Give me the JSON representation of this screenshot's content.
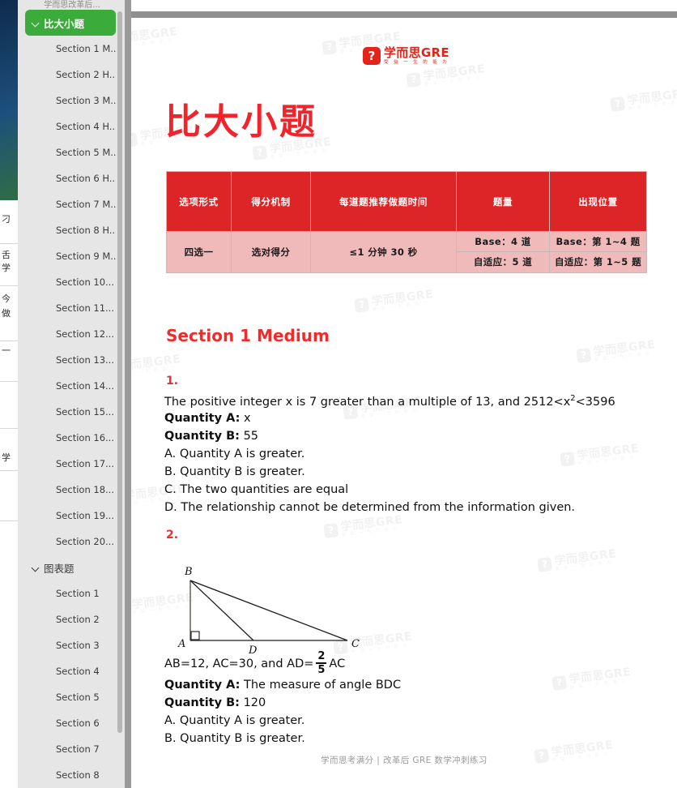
{
  "background_window": {
    "glyph_fragments": [
      "刁",
      "舌",
      "学",
      "今",
      "做",
      "一",
      "学"
    ]
  },
  "sidebar": {
    "partial_top_label": "学而思改革后...",
    "groups": [
      {
        "label": "比大小题",
        "expanded": true,
        "active": true,
        "icon": "chevron-down-icon",
        "items": [
          "Section 1 M...",
          "Section 2 H...",
          "Section 3 M...",
          "Section 4 H...",
          "Section 5 M...",
          "Section 6 H...",
          "Section 7 M...",
          "Section 8 H...",
          "Section 9 M...",
          "Section 10...",
          "Section 11...",
          "Section 12...",
          "Section 13...",
          "Section 14...",
          "Section 15...",
          "Section 16...",
          "Section 17...",
          "Section 18...",
          "Section 19...",
          "Section 20..."
        ]
      },
      {
        "label": "图表题",
        "expanded": true,
        "active": false,
        "icon": "chevron-down-icon",
        "items": [
          "Section 1",
          "Section 2",
          "Section 3",
          "Section 4",
          "Section 5",
          "Section 6",
          "Section 7",
          "Section 8"
        ]
      }
    ],
    "scrollbar": {
      "name": "sidebar-scrollbar"
    }
  },
  "document": {
    "logo": {
      "badge_glyph": "?",
      "main": "学而思GRE",
      "tagline": "受 益 一 生 的 能 力"
    },
    "title": "比大小题",
    "watermark": {
      "badge_glyph": "?",
      "main": "学而思GRE",
      "sub": "受 益 一 生 的 能 力"
    },
    "info_table": {
      "headers": [
        "选项形式",
        "得分机制",
        "每道题推荐做题时间",
        "题量",
        "出现位置"
      ],
      "row": {
        "option_form": "四选一",
        "scoring": "选对得分",
        "time_per_question": "≤1 分钟 30 秒",
        "quantity": {
          "base": "Base：4 道",
          "adaptive": "自适应：5 道"
        },
        "position": {
          "base": "Base：第 1~4 题",
          "adaptive": "自适应：第 1~5 题"
        }
      }
    },
    "section_heading": "Section 1 Medium",
    "questions": [
      {
        "number": "1.",
        "stem": "The positive integer x is 7 greater than a multiple of 13, and 2512<x",
        "stem_sup": "2",
        "stem_tail": "<3596",
        "quantity_a_label": "Quantity A:",
        "quantity_a_value": "x",
        "quantity_b_label": "Quantity B:",
        "quantity_b_value": "55",
        "choices": [
          "A. Quantity A is greater.",
          "B. Quantity B is greater.",
          "C. The two quantities are equal",
          "D. The relationship cannot be determined from the information given."
        ]
      },
      {
        "number": "2.",
        "figure": {
          "name": "triangle-abc-diagram",
          "vertex_labels": [
            "B",
            "A",
            "D",
            "C"
          ],
          "right_angle_at": "A"
        },
        "given_prefix": "AB=12, AC=30, and AD=",
        "given_fraction_num": "2",
        "given_fraction_den": "5",
        "given_suffix": "AC",
        "quantity_a_label": "Quantity A:",
        "quantity_a_value": "The measure of angle BDC",
        "quantity_b_label": "Quantity B:",
        "quantity_b_value": "120",
        "choices": [
          "A. Quantity A is greater.",
          "B. Quantity B is greater."
        ]
      }
    ],
    "footer": "学而思考满分 | 改革后 GRE 数学冲刺练习"
  },
  "colors": {
    "brand_red": "#e1251b",
    "title_red": "#f0242a",
    "heading_red": "#ef2b2b",
    "table_header_red": "#dd2527",
    "table_body_pink": "#f0b9ba",
    "active_nav_green": "#3bab3b"
  }
}
